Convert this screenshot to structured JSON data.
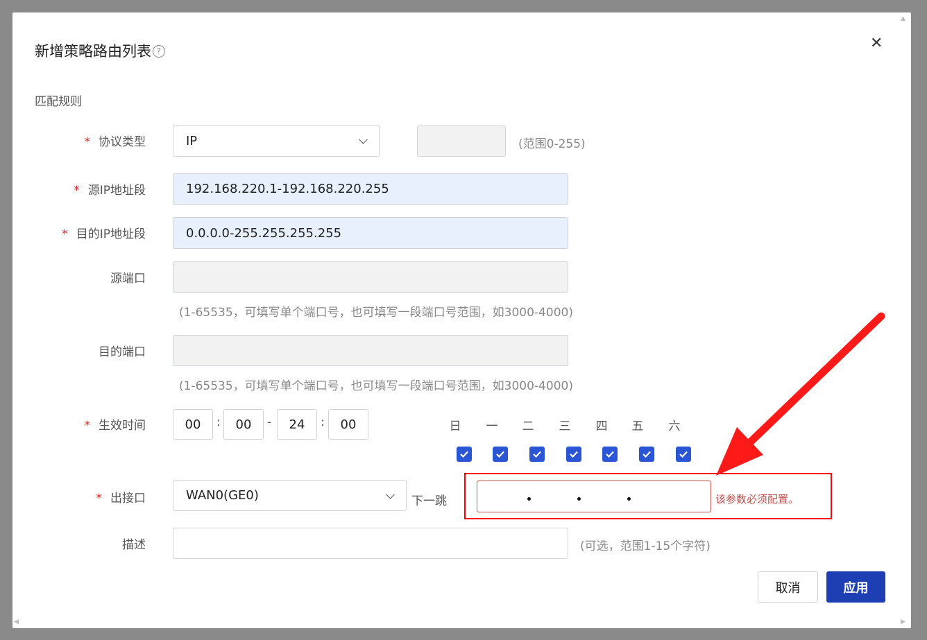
{
  "dialog": {
    "title": "新增策略路由列表",
    "help_icon": "?",
    "close_icon": "✕",
    "section_title": "匹配规则"
  },
  "fields": {
    "protocol": {
      "label": "协议类型",
      "value": "IP",
      "range_hint": "(范围0-255)"
    },
    "src_ip": {
      "label": "源IP地址段",
      "value": "192.168.220.1-192.168.220.255"
    },
    "dst_ip": {
      "label": "目的IP地址段",
      "value": "0.0.0.0-255.255.255.255"
    },
    "src_port": {
      "label": "源端口",
      "value": "",
      "hint": "(1-65535，可填写单个端口号，也可填写一段端口号范围，如3000-4000)"
    },
    "dst_port": {
      "label": "目的端口",
      "value": "",
      "hint": "(1-65535，可填写单个端口号，也可填写一段端口号范围，如3000-4000)"
    },
    "effective_time": {
      "label": "生效时间",
      "start_hour": "00",
      "start_min": "00",
      "end_hour": "24",
      "end_min": "00",
      "colon": ":",
      "dash": "-",
      "days": [
        "日",
        "一",
        "二",
        "三",
        "四",
        "五",
        "六"
      ],
      "days_checked": [
        true,
        true,
        true,
        true,
        true,
        true,
        true
      ]
    },
    "out_interface": {
      "label": "出接口",
      "value": "WAN0(GE0)",
      "next_hop_label": "下一跳",
      "next_hop_value": "",
      "error": "该参数必须配置。"
    },
    "description": {
      "label": "描述",
      "value": "",
      "hint": "(可选，范围1-15个字符)"
    }
  },
  "buttons": {
    "cancel": "取消",
    "apply": "应用"
  },
  "colors": {
    "primary": "#1e3fb3",
    "error": "#c0504d",
    "annotation": "#ff0000",
    "required": "#e02020"
  }
}
